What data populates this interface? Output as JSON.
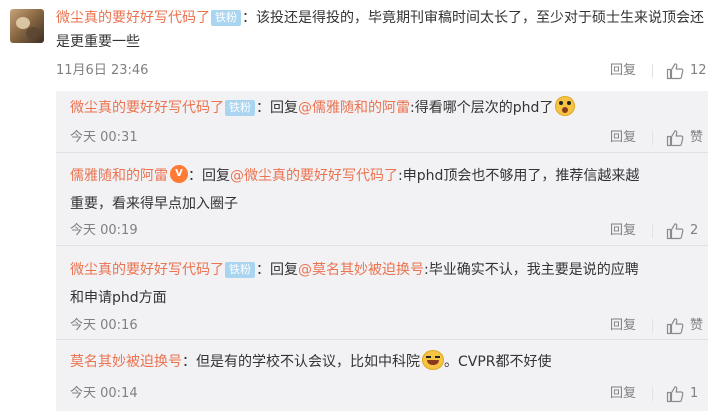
{
  "comment": {
    "username": "微尘真的要好好写代码了",
    "badge": "铁粉",
    "text": "：该投还是得投的，毕竟期刊审稿时间太长了，至少对于硕士生来说顶会还是更重要一些",
    "time": "11月6日 23:46",
    "reply_label": "回复",
    "like_count": "12"
  },
  "replies": [
    {
      "username": "微尘真的要好好写代码了",
      "badge": "铁粉",
      "sep": "：",
      "reply_prefix": "回复",
      "target": "@儒雅随和的阿雷",
      "text": ":得看哪个层次的phd了",
      "time": "今天 00:31",
      "reply_label": "回复",
      "like_label": "赞",
      "emoji": "shock-face-icon"
    },
    {
      "username": "儒雅随和的阿雷",
      "badge": "",
      "sep": "：",
      "reply_prefix": "回复",
      "target": "@微尘真的要好好写代码了",
      "text": ":申phd顶会也不够用了，推荐信越来越重要，看来得早点加入圈子",
      "time": "今天 00:19",
      "reply_label": "回复",
      "like_label": "2",
      "emoji": "vip-badge-icon"
    },
    {
      "username": "微尘真的要好好写代码了",
      "badge": "铁粉",
      "sep": "：",
      "reply_prefix": "回复",
      "target": "@莫名其妙被迫换号",
      "text": ":毕业确实不认，我主要是说的应聘和申请phd方面",
      "time": "今天 00:16",
      "reply_label": "回复",
      "like_label": "赞",
      "emoji": ""
    },
    {
      "username": "莫名其妙被迫换号",
      "badge": "",
      "sep": "：",
      "text": "但是有的学校不认会议，比如中科院",
      "text_after": "。CVPR都不好使",
      "time": "今天 00:14",
      "reply_label": "回复",
      "like_label": "1",
      "emoji": "laugh-cry-icon"
    }
  ],
  "colors": {
    "username": "#eb7350",
    "badge_bg": "#a9d5f0",
    "reply_panel_bg": "#f2f2f5",
    "meta_gray": "#808080"
  }
}
